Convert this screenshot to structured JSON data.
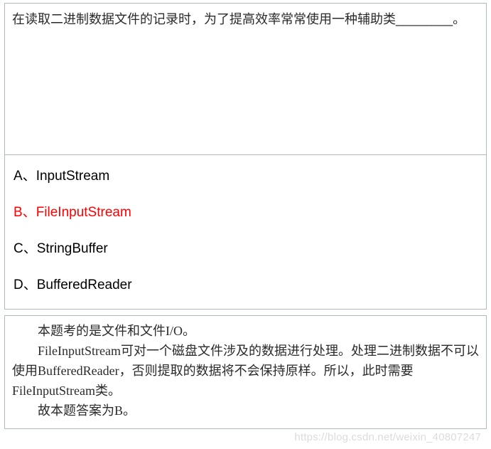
{
  "question": {
    "stem": "在读取二进制数据文件的记录时，为了提高效率常常使用一种辅助类________。"
  },
  "options": [
    {
      "label": "A、",
      "text": "InputStream",
      "correct": false
    },
    {
      "label": "B、",
      "text": "FileInputStream",
      "correct": true
    },
    {
      "label": "C、",
      "text": "StringBuffer",
      "correct": false
    },
    {
      "label": "D、",
      "text": "BufferedReader",
      "correct": false
    }
  ],
  "explanation": {
    "lines": [
      "本题考的是文件和文件I/O。",
      "FileInputStream可对一个磁盘文件涉及的数据进行处理。处理二进制数据不可以使用BufferedReader，否则提取的数据将不会保持原样。所以，此时需要FileInputStream类。",
      "故本题答案为B。"
    ]
  },
  "watermark": "https://blog.csdn.net/weixin_40807247"
}
